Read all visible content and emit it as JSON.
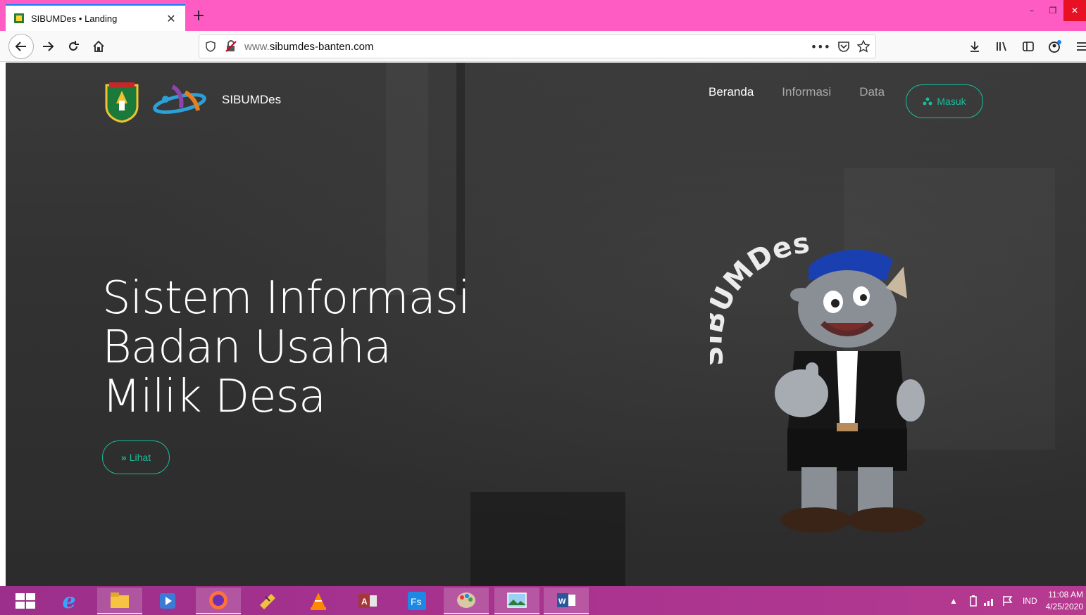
{
  "browser": {
    "tab_title": "SIBUMDes • Landing",
    "tab_close": "✕",
    "new_tab": "+",
    "url_host_prefix": "www.",
    "url_domain": "sibumdes-banten.com",
    "window_minimize": "–",
    "window_restore": "❐",
    "window_close": "✕"
  },
  "site": {
    "brand_name": "SIBUMDes",
    "nav": {
      "home": "Beranda",
      "info": "Informasi",
      "data": "Data"
    },
    "login_button": "Masuk",
    "hero_line1": "Sistem Informasi",
    "hero_line2": "Badan Usaha",
    "hero_line3": "Milik Desa",
    "view_button": "Lihat",
    "mascot_text": "SIBUMDes",
    "accent_color": "#1abc9c"
  },
  "taskbar": {
    "language": "IND",
    "time": "11:08 AM",
    "date": "4/25/2020"
  }
}
